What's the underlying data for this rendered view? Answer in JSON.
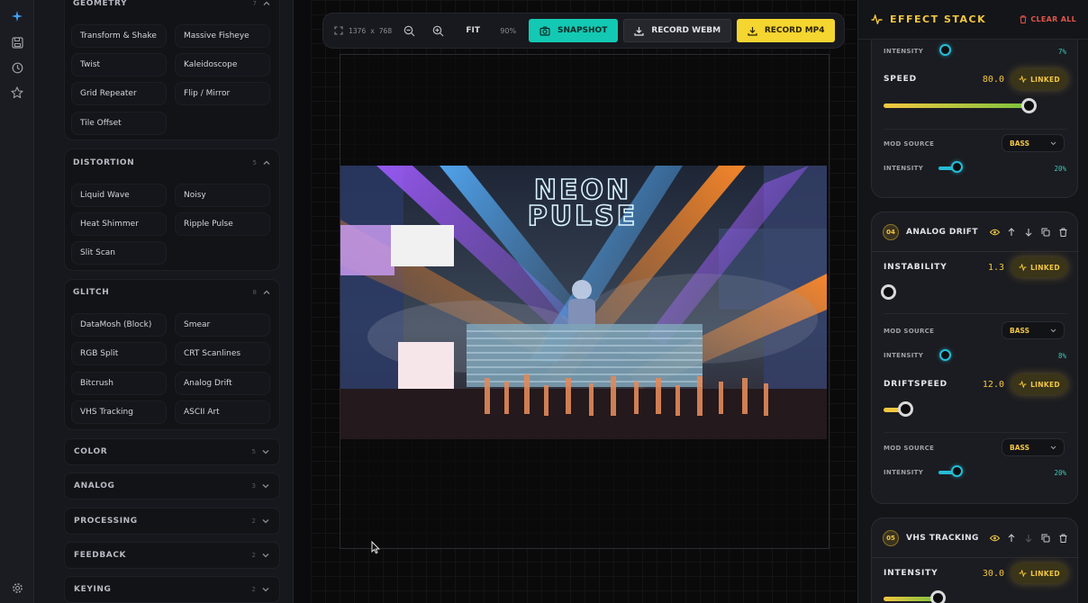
{
  "colors": {
    "accent_yellow": "#f3c740",
    "accent_teal": "#25bcd6",
    "danger": "#e0554a",
    "snapshot_bg": "#13c9b3",
    "record_mp4_bg": "#f5d530"
  },
  "rail": {
    "icons": [
      "sparkle-icon",
      "save-icon",
      "history-icon",
      "star-icon",
      "settings-icon"
    ]
  },
  "library": {
    "geometry": {
      "title": "GEOMETRY",
      "count": "7",
      "items": [
        "Transform & Shake",
        "Massive Fisheye",
        "Twist",
        "Kaleidoscope",
        "Grid Repeater",
        "Flip / Mirror",
        "Tile Offset"
      ]
    },
    "distortion": {
      "title": "DISTORTION",
      "count": "5",
      "items": [
        "Liquid Wave",
        "Noisy",
        "Heat Shimmer",
        "Ripple Pulse",
        "Slit Scan"
      ]
    },
    "glitch": {
      "title": "GLITCH",
      "count": "8",
      "items": [
        "DataMosh (Block)",
        "Smear",
        "RGB Split",
        "CRT Scanlines",
        "Bitcrush",
        "Analog Drift",
        "VHS Tracking",
        "ASCII Art"
      ]
    },
    "collapsed": [
      {
        "title": "COLOR",
        "count": "5"
      },
      {
        "title": "ANALOG",
        "count": "3"
      },
      {
        "title": "PROCESSING",
        "count": "2"
      },
      {
        "title": "FEEDBACK",
        "count": "2"
      },
      {
        "title": "KEYING",
        "count": "2"
      }
    ]
  },
  "toolbar": {
    "resolution": "1376 x 768",
    "fit": "FIT",
    "zoom": "90%",
    "snapshot": "SNAPSHOT",
    "record_webm": "RECORD WEBM",
    "record_mp4": "RECORD MP4"
  },
  "preview": {
    "sign_line1": "NEON",
    "sign_line2": "PULSE"
  },
  "stack": {
    "title": "EFFECT STACK",
    "clear_all": "CLEAR ALL",
    "top_card": {
      "intensity_label": "INTENSITY",
      "intensity_value": "7%",
      "intensity_level": 0.07,
      "speed_label": "SPEED",
      "speed_value": "80.0",
      "speed_level": 0.8,
      "linked": "LINKED",
      "mod_source_label": "MOD SOURCE",
      "mod_source": "BASS",
      "intensity2_label": "INTENSITY",
      "intensity2_value": "20%",
      "intensity2_level": 0.2
    },
    "analog_drift": {
      "num": "04",
      "name": "ANALOG DRIFT",
      "instability_label": "INSTABILITY",
      "instability_value": "1.3",
      "instability_level": 0.0,
      "linked": "LINKED",
      "mod1_label": "MOD SOURCE",
      "mod1_source": "BASS",
      "int1_label": "INTENSITY",
      "int1_value": "8%",
      "int1_level": 0.08,
      "driftspeed_label": "DRIFTSPEED",
      "driftspeed_value": "12.0",
      "driftspeed_level": 0.12,
      "linked2": "LINKED",
      "mod2_label": "MOD SOURCE",
      "mod2_source": "BASS",
      "int2_label": "INTENSITY",
      "int2_value": "20%",
      "int2_level": 0.2
    },
    "vhs_tracking": {
      "num": "05",
      "name": "VHS TRACKING",
      "intensity_label": "INTENSITY",
      "intensity_value": "30.0",
      "intensity_level": 0.3,
      "linked": "LINKED"
    }
  }
}
